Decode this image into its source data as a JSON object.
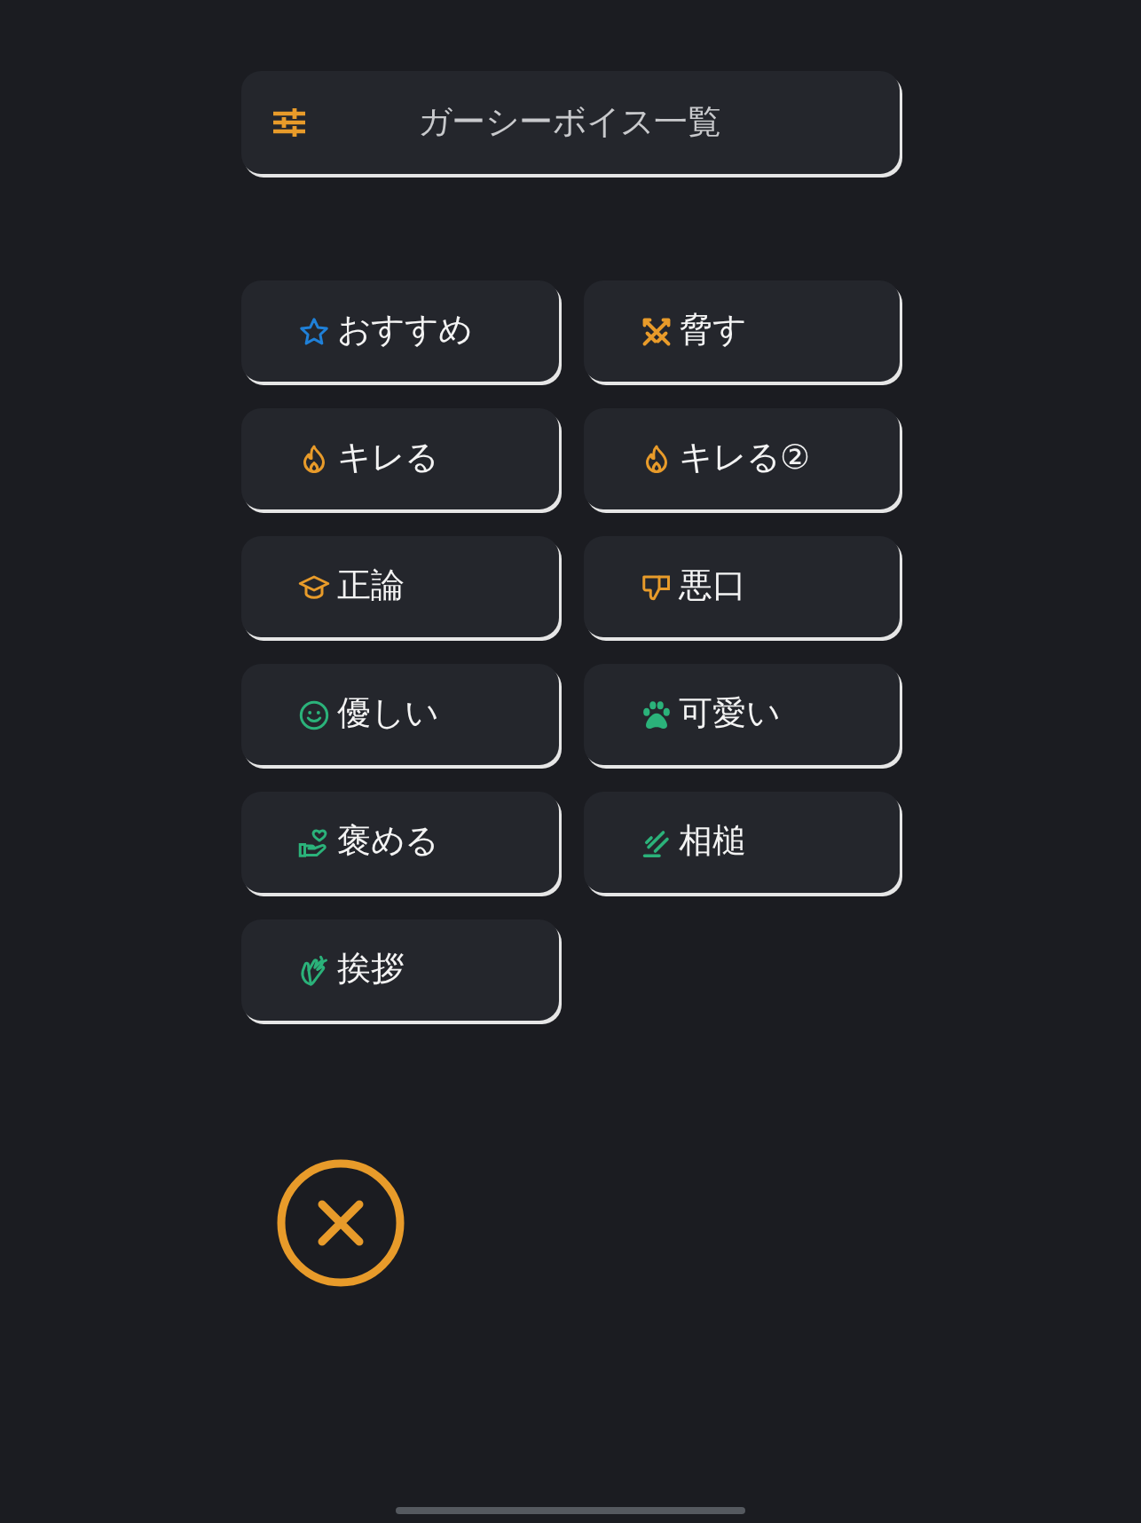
{
  "header": {
    "title": "ガーシーボイス一覧"
  },
  "categories": [
    {
      "label": "おすすめ",
      "color": "#1f80d8"
    },
    {
      "label": "脅す",
      "color": "#e89b2a"
    },
    {
      "label": "キレる",
      "color": "#e89b2a"
    },
    {
      "label": "キレる②",
      "color": "#e89b2a"
    },
    {
      "label": "正論",
      "color": "#e89b2a"
    },
    {
      "label": "悪口",
      "color": "#e89b2a"
    },
    {
      "label": "優しい",
      "color": "#2bb27a"
    },
    {
      "label": "可愛い",
      "color": "#2bb27a"
    },
    {
      "label": "褒める",
      "color": "#2bb27a"
    },
    {
      "label": "相槌",
      "color": "#2bb27a"
    },
    {
      "label": "挨拶",
      "color": "#2bb27a"
    }
  ]
}
